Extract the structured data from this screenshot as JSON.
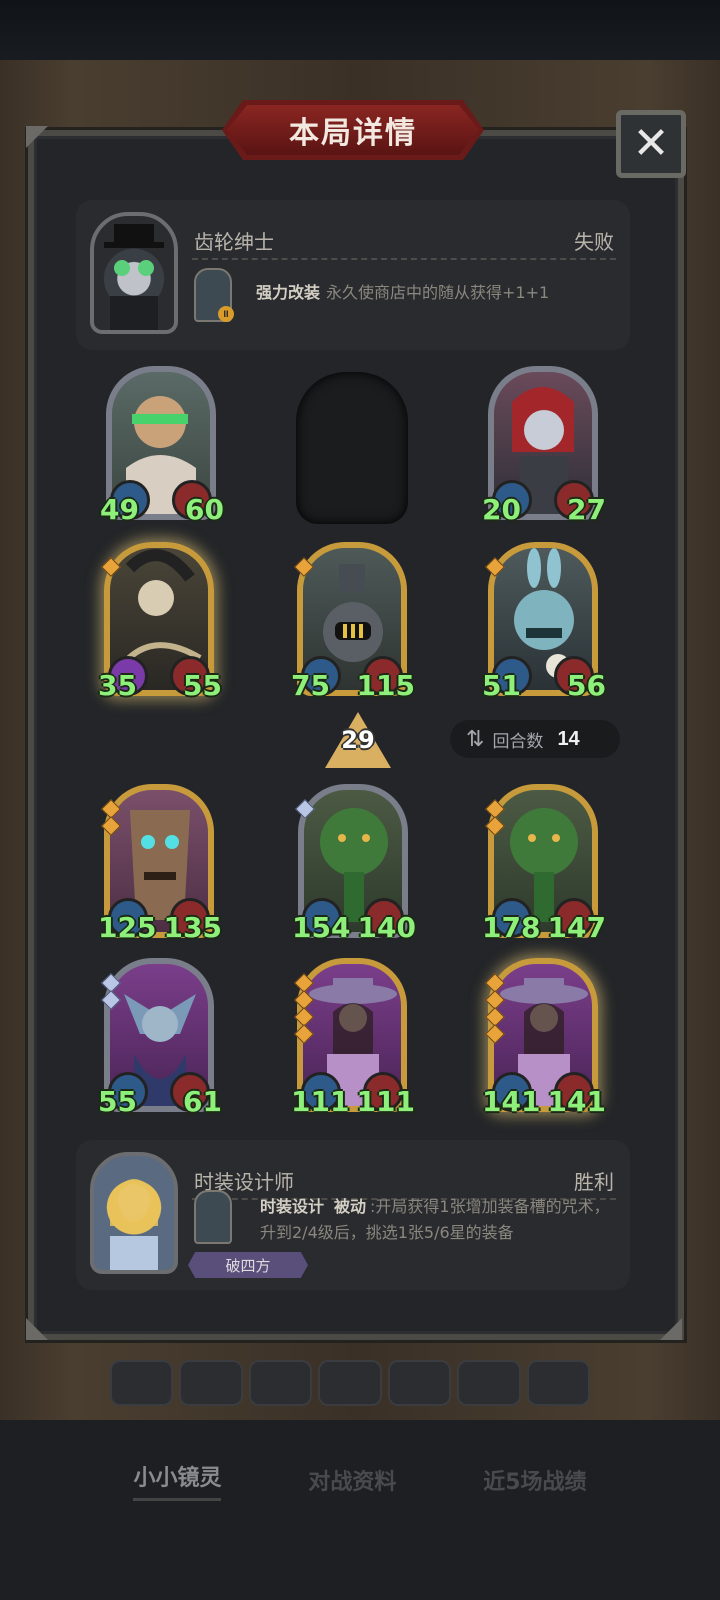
{
  "header": {
    "title": "本局详情",
    "close_icon": "close-icon"
  },
  "opponent": {
    "name": "齿轮绅士",
    "result": "失败",
    "skill_name": "强力改装",
    "skill_desc": "永久使商店中的随从获得+1+1",
    "hero_level_badge": "II"
  },
  "opponent_units": [
    {
      "atk": "49",
      "hp": "60"
    },
    {
      "atk": "",
      "hp": ""
    },
    {
      "atk": "20",
      "hp": "27"
    },
    {
      "atk": "35",
      "hp": "55"
    },
    {
      "atk": "75",
      "hp": "115"
    },
    {
      "atk": "51",
      "hp": "56"
    }
  ],
  "tavern_level": "29",
  "rounds": {
    "label": "回合数",
    "value": "14"
  },
  "player_units": [
    {
      "atk": "125",
      "hp": "135"
    },
    {
      "atk": "154",
      "hp": "140"
    },
    {
      "atk": "178",
      "hp": "147"
    },
    {
      "atk": "55",
      "hp": "61"
    },
    {
      "atk": "111",
      "hp": "111"
    },
    {
      "atk": "141",
      "hp": "141"
    }
  ],
  "player": {
    "name": "时装设计师",
    "result": "胜利",
    "skill_name": "时装设计",
    "skill_type": "被动",
    "skill_desc": ":开局获得1张增加装备槽的咒术，升到2/4级后，挑选1张5/6星的装备",
    "tag": "破四方"
  },
  "bottom_tabs": [
    "小小镜灵",
    "对战资料",
    "近5场战绩"
  ],
  "colors": {
    "stat_green": "#8ef07a",
    "banner_red": "#8a2622",
    "gold_frame": "#c79b3c"
  }
}
